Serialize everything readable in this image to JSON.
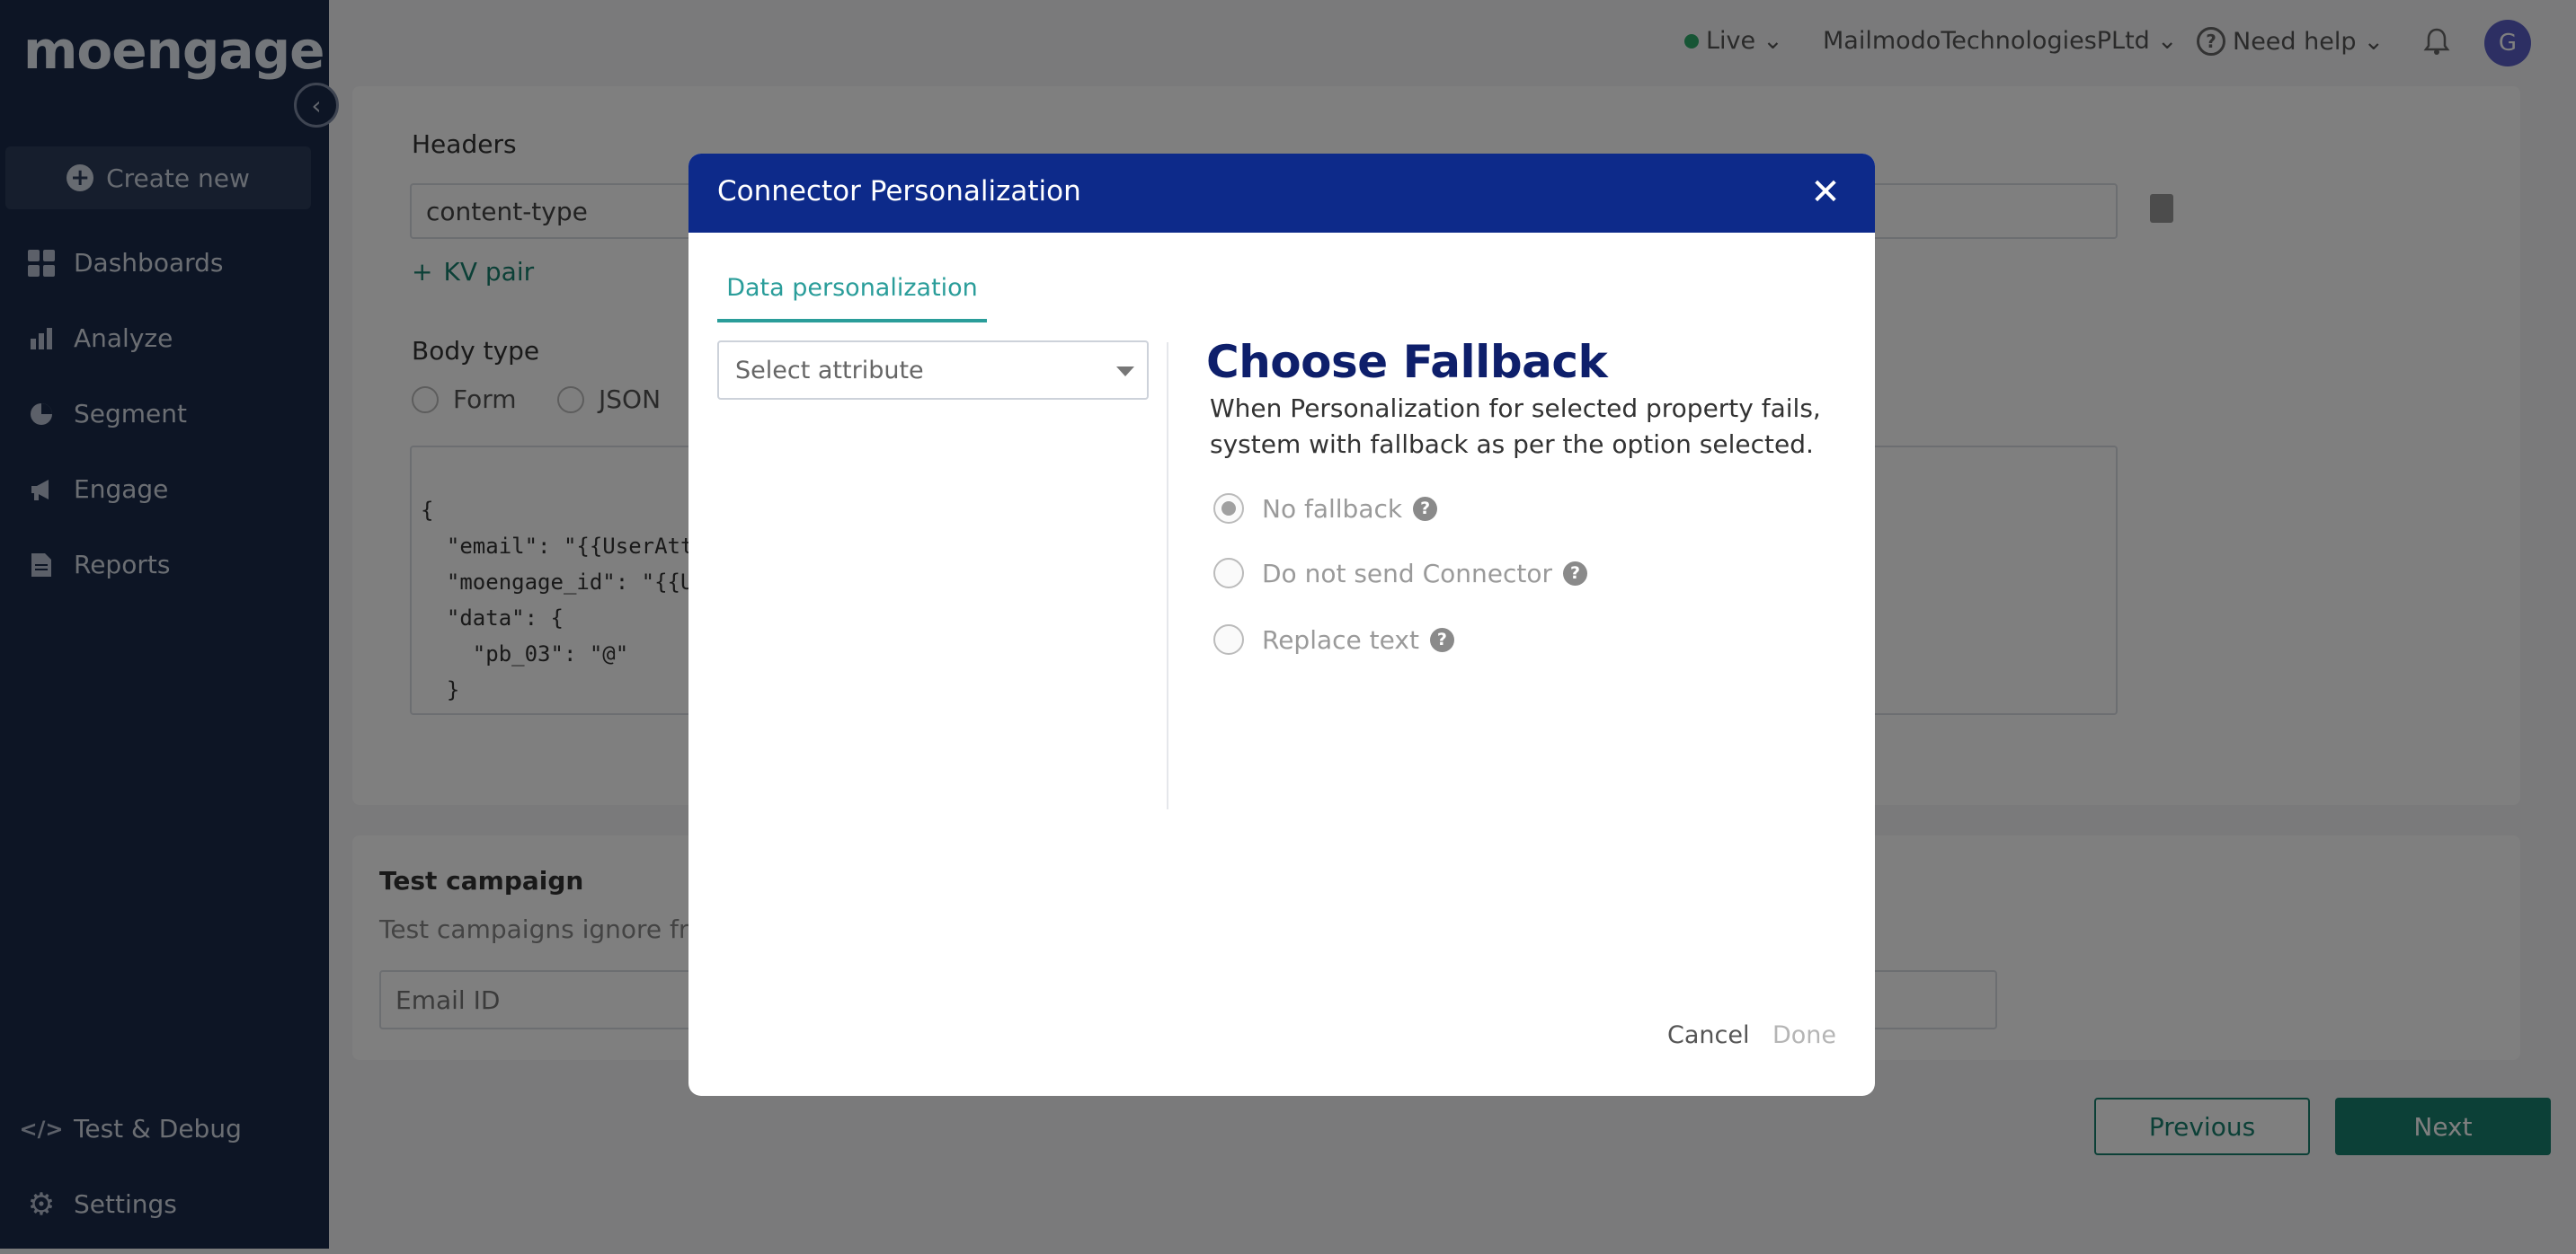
{
  "sidebar": {
    "logo": "moengage",
    "create_new": "Create new",
    "items": [
      {
        "label": "Dashboards",
        "icon": "dashboard-icon"
      },
      {
        "label": "Analyze",
        "icon": "bar-chart-icon"
      },
      {
        "label": "Segment",
        "icon": "pie-chart-icon"
      },
      {
        "label": "Engage",
        "icon": "megaphone-icon"
      },
      {
        "label": "Reports",
        "icon": "document-icon"
      }
    ],
    "bottom_items": [
      {
        "label": "Test & Debug",
        "icon": "code-icon"
      },
      {
        "label": "Settings",
        "icon": "gear-icon"
      }
    ]
  },
  "header": {
    "environment": "Live",
    "workspace": "MailmodoTechnologiesPLtd",
    "help": "Need help",
    "avatar_initial": "G"
  },
  "background": {
    "headers_label": "Headers",
    "header_key": "content-type",
    "kv_pair": "KV pair",
    "body_type_label": "Body type",
    "body_types": [
      "Form",
      "JSON"
    ],
    "code_lines": [
      "{",
      "  \"email\": \"{{UserAttribut",
      "  \"moengage_id\": \"{{Use",
      "  \"data\": {",
      "    \"pb_03\": \"@\"",
      "  }"
    ],
    "test_campaign_title": "Test campaign",
    "test_campaign_desc": "Test campaigns ignore frequ",
    "email_id_placeholder": "Email ID",
    "previous": "Previous",
    "next": "Next"
  },
  "modal": {
    "title": "Connector Personalization",
    "tab": "Data personalization",
    "select_placeholder": "Select attribute",
    "fallback_title": "Choose Fallback",
    "fallback_desc": "When Personalization for selected property fails, system with fallback as per the option selected.",
    "options": [
      {
        "label": "No fallback",
        "selected": true
      },
      {
        "label": "Do not send Connector",
        "selected": false
      },
      {
        "label": "Replace text",
        "selected": false
      }
    ],
    "cancel": "Cancel",
    "done": "Done"
  },
  "colors": {
    "sidebar_bg": "#1a2b4b",
    "modal_header": "#0d2a8a",
    "accent_teal": "#2a9d9a",
    "fallback_title": "#0e1f6b"
  }
}
